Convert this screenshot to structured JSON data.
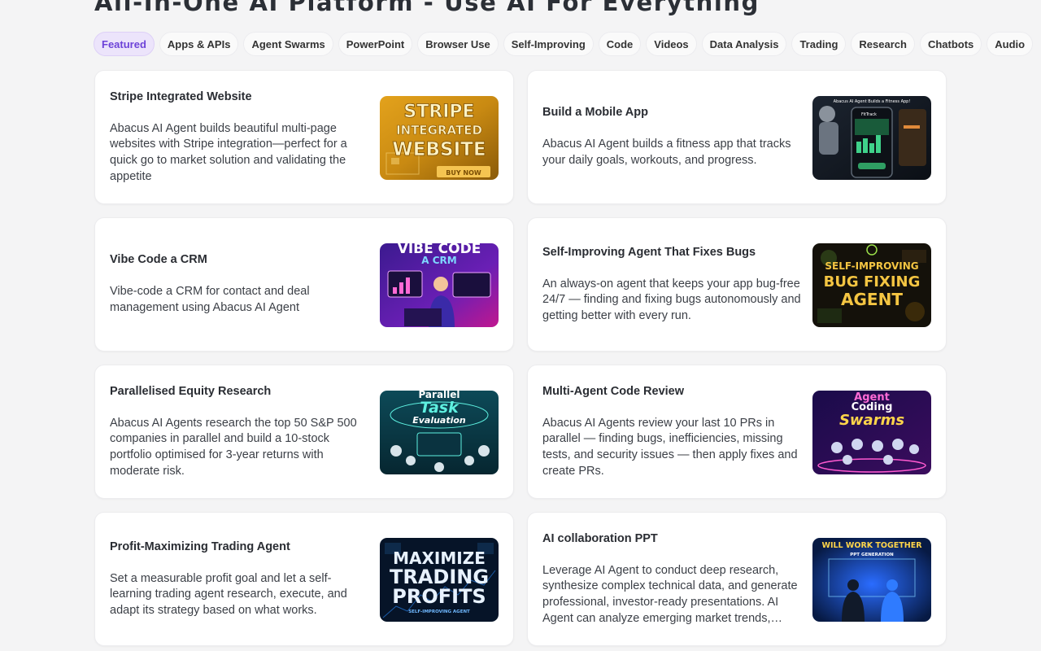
{
  "page": {
    "title": "All-In-One AI Platform - Use AI For Everything"
  },
  "tabs": [
    {
      "label": "Featured",
      "active": true
    },
    {
      "label": "Apps & APIs",
      "active": false
    },
    {
      "label": "Agent Swarms",
      "active": false
    },
    {
      "label": "PowerPoint",
      "active": false
    },
    {
      "label": "Browser Use",
      "active": false
    },
    {
      "label": "Self-Improving",
      "active": false
    },
    {
      "label": "Code",
      "active": false
    },
    {
      "label": "Videos",
      "active": false
    },
    {
      "label": "Data Analysis",
      "active": false
    },
    {
      "label": "Trading",
      "active": false
    },
    {
      "label": "Research",
      "active": false
    },
    {
      "label": "Chatbots",
      "active": false
    },
    {
      "label": "Audio",
      "active": false
    }
  ],
  "cards": [
    {
      "title": "Stripe Integrated Website",
      "description": "Abacus AI Agent builds beautiful multi-page websites with Stripe integration—perfect for a quick go to market solution and validating the appetite",
      "thumbnail": {
        "line1": "STRIPE",
        "line2": "INTEGRATED",
        "line3": "WEBSITE",
        "badge": "BUY NOW"
      }
    },
    {
      "title": "Build a Mobile App",
      "description": "Abacus AI Agent builds a fitness app that tracks your daily goals, workouts, and progress.",
      "thumbnail": {
        "caption": "Abacus AI Agent Builds a Fitness App!",
        "app_name": "FitTrack"
      }
    },
    {
      "title": "Vibe Code a CRM",
      "description": "Vibe-code a CRM for contact and deal management using Abacus AI Agent",
      "thumbnail": {
        "line1": "VIBE CODE",
        "line2": "A CRM"
      }
    },
    {
      "title": "Self-Improving Agent That Fixes Bugs",
      "description": "An always-on agent that keeps your app bug-free 24/7 — finding and fixing bugs autonomously and getting better with every run.",
      "thumbnail": {
        "line1": "SELF-IMPROVING",
        "line2": "BUG FIXING",
        "line3": "AGENT"
      }
    },
    {
      "title": "Parallelised Equity Research",
      "description": "Abacus AI Agents research the top 50 S&P 500 companies in parallel and build a 10-stock portfolio optimised for 3-year returns with moderate risk.",
      "thumbnail": {
        "line1": "Parallel",
        "line2": "Task",
        "line3": "Evaluation"
      }
    },
    {
      "title": "Multi-Agent Code Review",
      "description": "Abacus AI Agents review your last 10 PRs in parallel — finding bugs, inefficiencies, missing tests, and security issues — then apply fixes and create PRs.",
      "thumbnail": {
        "line1": "Agent",
        "line2": "Coding",
        "line3": "Swarms"
      }
    },
    {
      "title": "Profit-Maximizing Trading Agent",
      "description": "Set a measurable profit goal and let a self-learning trading agent research, execute, and adapt its strategy based on what works.",
      "thumbnail": {
        "line1": "MAXIMIZE",
        "line2": "TRADING",
        "line3": "PROFITS",
        "badge": "SELF-IMPROVING AGENT"
      }
    },
    {
      "title": "AI collaboration PPT",
      "description": "Leverage AI Agent to conduct deep research, synthesize complex technical data, and generate professional, investor-ready presentations. AI Agent can analyze emerging market trends, identify key competitors, and more.",
      "thumbnail": {
        "line1": "WILL WORK TOGETHER",
        "line2": "PPT GENERATION"
      }
    }
  ],
  "colors": {
    "accent": "#6d43d8",
    "active_tab_bg": "#ece4fb",
    "page_bg": "#f4f4f5"
  }
}
